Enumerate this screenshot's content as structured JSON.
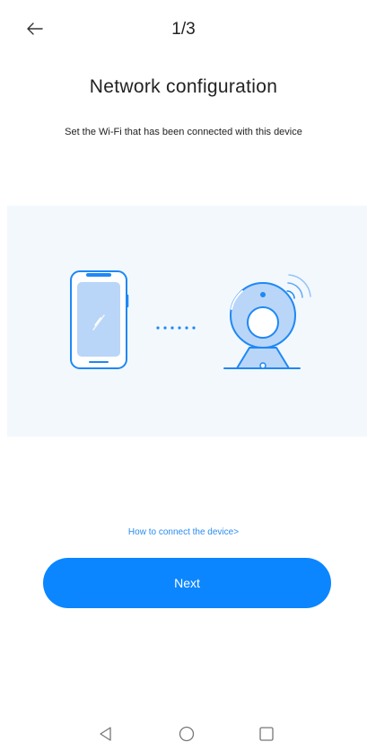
{
  "header": {
    "step": "1/3"
  },
  "main": {
    "title": "Network configuration",
    "subtitle": "Set the Wi-Fi that has been connected with this device",
    "help_link": "How to connect the device>",
    "next_label": "Next"
  },
  "colors": {
    "accent": "#0b86ff",
    "link": "#2a8cf0",
    "illustration_bg": "#f3f8fd",
    "illustration_stroke": "#1e88f5",
    "illustration_fill": "#b9d6f8"
  },
  "icons": {
    "back": "arrow-left-icon",
    "phone": "phone-icon",
    "camera": "camera-icon",
    "nav_back": "triangle-back-icon",
    "nav_home": "circle-home-icon",
    "nav_recent": "square-recent-icon"
  }
}
